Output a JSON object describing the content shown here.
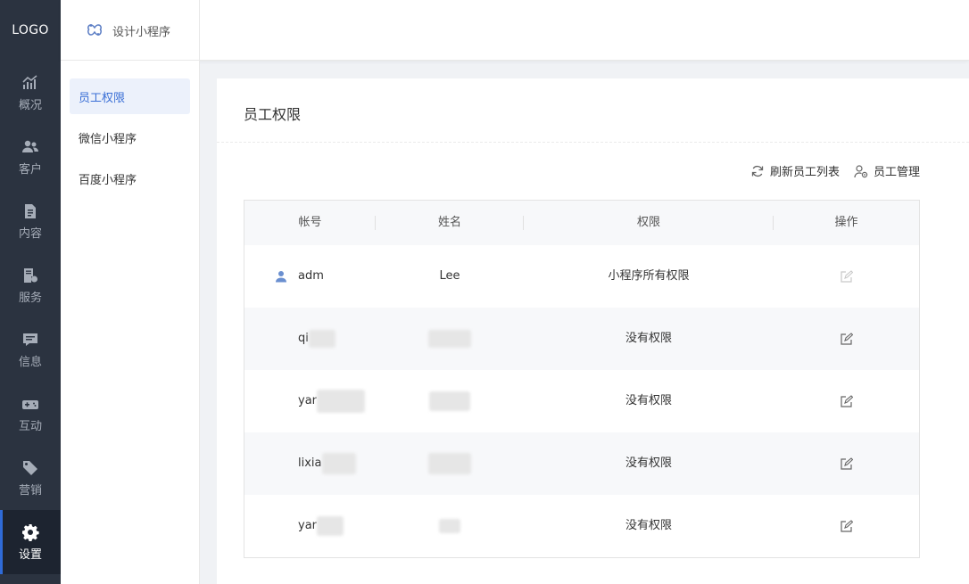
{
  "nav": {
    "logo": "LOGO",
    "items": [
      {
        "label": "概况",
        "icon": "chart-trend-icon"
      },
      {
        "label": "客户",
        "icon": "users-icon"
      },
      {
        "label": "内容",
        "icon": "document-icon"
      },
      {
        "label": "服务",
        "icon": "service-icon"
      },
      {
        "label": "信息",
        "icon": "message-icon"
      },
      {
        "label": "互动",
        "icon": "gamepad-icon"
      },
      {
        "label": "营销",
        "icon": "tag-icon"
      },
      {
        "label": "设置",
        "icon": "gear-icon",
        "active": true
      }
    ]
  },
  "header": {
    "app_title": "设计小程序",
    "app_icon": "miniprogram-icon"
  },
  "subnav": {
    "items": [
      {
        "label": "员工权限",
        "active": true
      },
      {
        "label": "微信小程序"
      },
      {
        "label": "百度小程序"
      }
    ]
  },
  "main": {
    "title": "员工权限",
    "toolbar": {
      "refresh_label": "刷新员工列表",
      "manage_label": "员工管理"
    },
    "table": {
      "columns": [
        "帐号",
        "姓名",
        "权限",
        "操作"
      ],
      "rows": [
        {
          "account": "adm",
          "name": "Lee",
          "permission": "小程序所有权限",
          "is_admin": true
        },
        {
          "account": "qi",
          "name": "",
          "permission": "没有权限"
        },
        {
          "account": "yar",
          "name": "",
          "permission": "没有权限"
        },
        {
          "account": "lixia",
          "name": "",
          "permission": "没有权限"
        },
        {
          "account": "yar",
          "name": "",
          "permission": "没有权限"
        }
      ]
    }
  },
  "colors": {
    "nav_bg": "#2b3340",
    "accent": "#3a6fd6",
    "active_sub_bg": "#ecf1fb"
  }
}
